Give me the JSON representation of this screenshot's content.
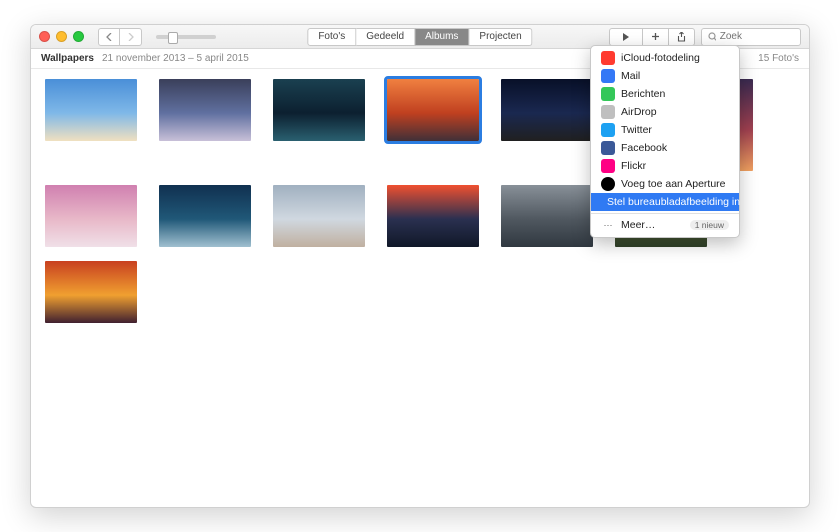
{
  "toolbar": {
    "tabs": {
      "photos": "Foto's",
      "shared": "Gedeeld",
      "albums": "Albums",
      "projects": "Projecten"
    },
    "search_placeholder": "Zoek"
  },
  "subheader": {
    "title": "Wallpapers",
    "date_range": "21 november 2013 – 5 april 2015",
    "count": "15 Foto's"
  },
  "share_menu": {
    "items": [
      {
        "label": "iCloud-fotodeling",
        "color": "#ff3b30"
      },
      {
        "label": "Mail",
        "color": "#3478f6"
      },
      {
        "label": "Berichten",
        "color": "#34c759"
      },
      {
        "label": "AirDrop",
        "color": "#bfbfbf"
      },
      {
        "label": "Twitter",
        "color": "#1da1f2"
      },
      {
        "label": "Facebook",
        "color": "#3b5998"
      },
      {
        "label": "Flickr",
        "color": "#ff0084"
      },
      {
        "label": "Voeg toe aan Aperture",
        "color": "#000"
      }
    ],
    "highlighted": "Stel bureaubladafbeelding in",
    "more": "Meer…",
    "badge": "1 nieuw"
  },
  "thumbs": [
    {
      "id": "t1",
      "tall": false,
      "g": [
        "#4a8fd8",
        "#7fb8e8",
        "#f0e0c0"
      ]
    },
    {
      "id": "t2",
      "tall": false,
      "g": [
        "#3a3f5a",
        "#6070a0",
        "#c8c0d8"
      ]
    },
    {
      "id": "t3",
      "tall": false,
      "g": [
        "#1a4050",
        "#0c2030",
        "#2a6070"
      ]
    },
    {
      "id": "t4",
      "tall": false,
      "g": [
        "#f08040",
        "#c04020",
        "#403038"
      ],
      "selected": true
    },
    {
      "id": "t5",
      "tall": false,
      "g": [
        "#081028",
        "#1a2850",
        "#202020"
      ]
    },
    {
      "id": "t6",
      "tall": true,
      "g": [
        "#2a3a70",
        "#4a5a90",
        "#8890b0"
      ]
    },
    {
      "id": "t7",
      "tall": true,
      "g": [
        "#3a2a50",
        "#a04050",
        "#f0a060"
      ]
    },
    {
      "id": "t8",
      "tall": false,
      "g": [
        "#d080b0",
        "#e8b8c8",
        "#f0e0e8"
      ]
    },
    {
      "id": "t9",
      "tall": false,
      "g": [
        "#103050",
        "#205878",
        "#a0c0d0"
      ]
    },
    {
      "id": "t10",
      "tall": false,
      "g": [
        "#a0b0c0",
        "#d0d8e0",
        "#c0b0a0"
      ]
    },
    {
      "id": "t11",
      "tall": false,
      "g": [
        "#f05030",
        "#2a3050",
        "#101828"
      ]
    },
    {
      "id": "t12",
      "tall": false,
      "g": [
        "#889098",
        "#505860",
        "#303840"
      ]
    },
    {
      "id": "t13",
      "tall": false,
      "g": [
        "#a09060",
        "#607040",
        "#304028"
      ]
    },
    {
      "id": "t14",
      "tall": false,
      "g": [
        "#c84020",
        "#f0a030",
        "#402030"
      ]
    }
  ]
}
